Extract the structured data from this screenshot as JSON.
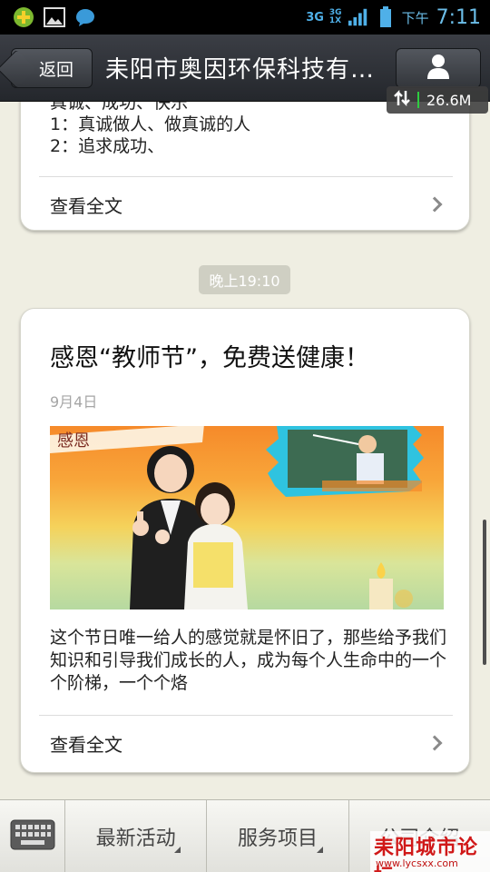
{
  "status_bar": {
    "network_1": "3G",
    "network_2": "3G",
    "network_2_sub": "1X",
    "time_prefix": "下午",
    "time": "7:11",
    "icons": [
      "add-icon",
      "gallery-icon",
      "chat-bubble-icon"
    ]
  },
  "header": {
    "back_label": "返回",
    "title": "耒阳市奥因环保科技有限公司",
    "traffic": "26.6M"
  },
  "card1": {
    "lines": [
      "真诚、成功、快乐",
      "1：真诚做人、做真诚的人",
      "2：追求成功、"
    ],
    "read_more": "查看全文"
  },
  "timestamp": "晚上19:10",
  "card2": {
    "title": "感恩“教师节”，免费送健康！",
    "date": "9月4日",
    "banner_text": "感恩",
    "summary": "这个节日唯一给人的感觉就是怀旧了，那些给予我们知识和引导我们成长的人，成为每个人生命中的一个个阶梯，一个个烙",
    "read_more": "查看全文"
  },
  "bottom_menu": {
    "keyboard_icon": "keyboard-icon",
    "items": [
      "最新活动",
      "服务项目",
      "公司介绍"
    ]
  },
  "watermark": {
    "title": "耒阳城市论坛",
    "url": "www.lycsxx.com"
  }
}
